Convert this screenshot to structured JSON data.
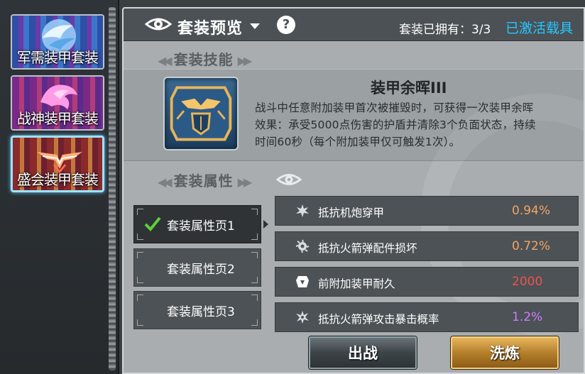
{
  "sidebar": {
    "items": [
      {
        "label": "军需装甲套装",
        "selected": false
      },
      {
        "label": "战神装甲套装",
        "selected": false
      },
      {
        "label": "盛会装甲套装",
        "selected": true
      }
    ]
  },
  "header": {
    "title": "套装预览",
    "help_symbol": "?",
    "owned_text": "套装已拥有：3/3",
    "vehicle_link": "已激活载具"
  },
  "skill_section": {
    "title": "套装技能",
    "skill_name": "装甲余晖III",
    "description_lines": [
      "战斗中任意附加装甲首次被摧毁时，可获得一次装甲余晖",
      "效果：承受5000点伤害的护盾并清除3个负面状态，持续",
      "时间60秒（每个附加装甲仅可触发1次）。"
    ]
  },
  "attribute_section": {
    "title": "套装属性",
    "tabs": [
      {
        "label": "套装属性页1",
        "active": true
      },
      {
        "label": "套装属性页2",
        "active": false
      },
      {
        "label": "套装属性页3",
        "active": false
      }
    ],
    "attributes": [
      {
        "name": "抵抗机炮穿甲",
        "value": "0.94%",
        "color": "#f2a463",
        "icon": "shell-burst-icon"
      },
      {
        "name": "抵抗火箭弹配件损坏",
        "value": "0.72%",
        "color": "#f2a463",
        "icon": "gear-burst-icon"
      },
      {
        "name": "前附加装甲耐久",
        "value": "2000",
        "color": "#ef5250",
        "icon": "armor-plate-icon"
      },
      {
        "name": "抵抗火箭弹攻击暴击概率",
        "value": "1.2%",
        "color": "#d07cff",
        "icon": "rocket-burst-icon"
      }
    ]
  },
  "buttons": {
    "sortie": "出战",
    "refine": "洗炼"
  },
  "colors": {
    "accent_link": "#28c6ff",
    "selected_border": "#9fe2ff",
    "panel_bg": "#a9adb0",
    "dark_panel": "#4b5155"
  }
}
